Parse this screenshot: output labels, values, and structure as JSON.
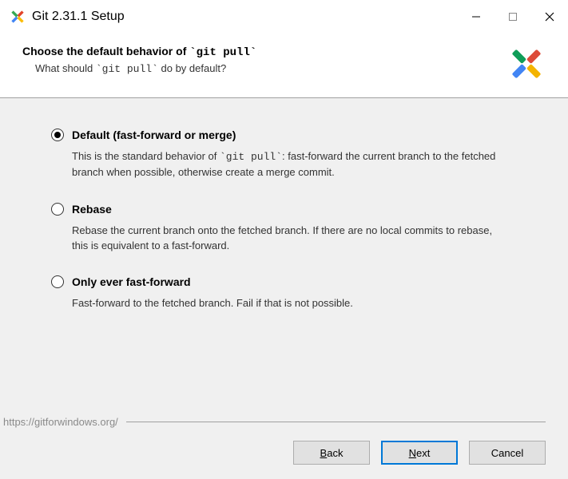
{
  "titlebar": {
    "title": "Git 2.31.1 Setup"
  },
  "header": {
    "heading_before": "Choose the default behavior of ",
    "heading_code": "`git pull`",
    "subtitle_before": "What should ",
    "subtitle_code": "`git pull`",
    "subtitle_after": " do by default?"
  },
  "options": {
    "default": {
      "label": "Default (fast-forward or merge)",
      "desc_before": "This is the standard behavior of ",
      "desc_code": "`git pull`",
      "desc_after": ": fast-forward the current branch to the fetched branch when possible, otherwise create a merge commit.",
      "selected": true
    },
    "rebase": {
      "label": "Rebase",
      "desc": "Rebase the current branch onto the fetched branch. If there are no local commits to rebase, this is equivalent to a fast-forward.",
      "selected": false
    },
    "ffonly": {
      "label": "Only ever fast-forward",
      "desc": "Fast-forward to the fetched branch. Fail if that is not possible.",
      "selected": false
    }
  },
  "footer": {
    "url": "https://gitforwindows.org/",
    "back_m": "B",
    "back_rest": "ack",
    "next_m": "N",
    "next_rest": "ext",
    "cancel": "Cancel"
  }
}
